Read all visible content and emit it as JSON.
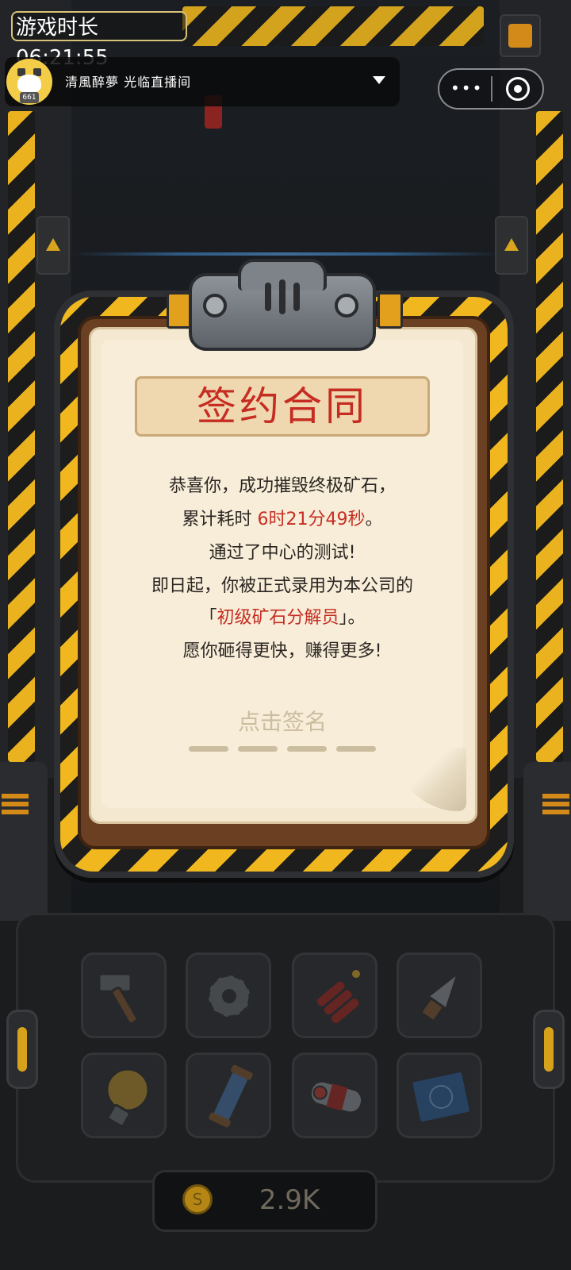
{
  "timer": {
    "label": "游戏时长",
    "value": "06:21:55"
  },
  "live": {
    "text": "清風醉夢  光临直播间",
    "avatar_badge": "661"
  },
  "capsule": {
    "menu_icon": "more-dots-icon",
    "close_icon": "target-icon"
  },
  "contract": {
    "title": "签约合同",
    "line1": "恭喜你，成功摧毁终极矿石，",
    "line2_prefix": "累计耗时 ",
    "line2_time": "6时21分49秒",
    "line2_suffix": "。",
    "line3": "通过了中心的测试!",
    "line4": "即日起，你被正式录用为本公司的",
    "line5_open": "「",
    "line5_role": "初级矿石分解员",
    "line5_close": "」。",
    "line6": "愿你砸得更快，赚得更多!",
    "sign_hint": "点击签名"
  },
  "tools": [
    {
      "name": "hammer-icon"
    },
    {
      "name": "gear-icon"
    },
    {
      "name": "dynamite-icon"
    },
    {
      "name": "drill-icon"
    },
    {
      "name": "lightbulb-icon"
    },
    {
      "name": "energy-tube-icon"
    },
    {
      "name": "capsule-device-icon"
    },
    {
      "name": "blueprint-icon"
    }
  ],
  "coins": {
    "symbol": "S",
    "value": "2.9K"
  },
  "colors": {
    "accent_red": "#c62d22",
    "hazard_yellow": "#f0b71e",
    "paper": "#f4e8d0"
  }
}
